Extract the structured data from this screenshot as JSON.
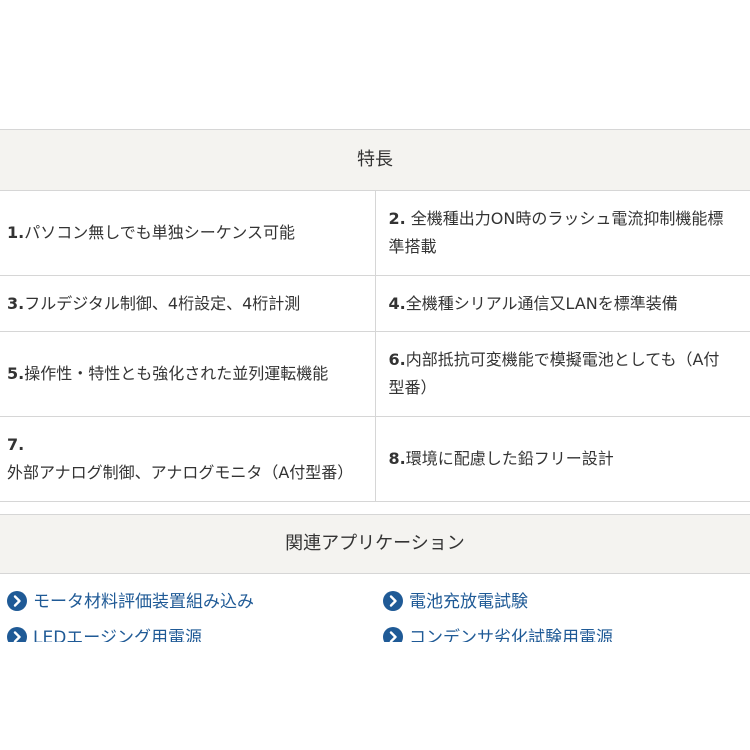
{
  "features": {
    "title": "特長",
    "items": [
      {
        "num": "1.",
        "text": "パソコン無しでも単独シーケンス可能"
      },
      {
        "num": "2.",
        "text": " 全機種出力ON時のラッシュ電流抑制機能標準搭載"
      },
      {
        "num": "3.",
        "text": "フルデジタル制御、4桁設定、4桁計測"
      },
      {
        "num": "4.",
        "text": "全機種シリアル通信又LANを標準装備"
      },
      {
        "num": "5.",
        "text": "操作性・特性とも強化された並列運転機能"
      },
      {
        "num": "6.",
        "text": "内部抵抗可変機能で模擬電池としても（A付型番）"
      },
      {
        "num": "7.",
        "text": "外部アナログ制御、アナログモニタ（A付型番）"
      },
      {
        "num": "8.",
        "text": "環境に配慮した鉛フリー設計"
      }
    ]
  },
  "related": {
    "title": "関連アプリケーション",
    "items": [
      {
        "label": "モータ材料評価装置組み込み",
        "icon": "chevron-right-circle-icon"
      },
      {
        "label": "電池充放電試験",
        "icon": "chevron-right-circle-icon"
      },
      {
        "label": "LEDエージング用電源",
        "icon": "chevron-right-circle-icon"
      },
      {
        "label": "コンデンサ劣化試験用電源",
        "icon": "chevron-right-circle-icon"
      }
    ]
  },
  "colors": {
    "header_bg": "#f4f3f0",
    "border": "#d6d6d6",
    "link": "#1f5a96",
    "text": "#333333"
  }
}
